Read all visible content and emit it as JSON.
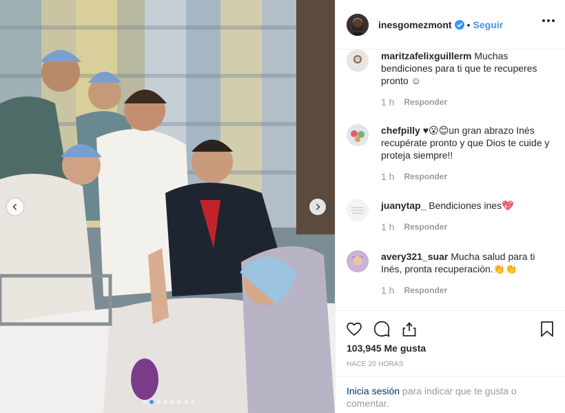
{
  "header": {
    "username": "inesgomezmont",
    "separator": "•",
    "follow_label": "Seguir",
    "verified_icon": "verified-badge-icon",
    "more_icon": "more-options-icon"
  },
  "comments": [
    {
      "user": "maritzafelixguillerm",
      "text": "Muchas bendiciones para ti que te recuperes pronto ☺",
      "time": "1 h",
      "reply": "Responder"
    },
    {
      "user": "chefpilly",
      "text": "♥😮😊un gran abrazo Inés recupérate pronto y que Dios te cuide y proteja siempre!!",
      "time": "1 h",
      "reply": "Responder"
    },
    {
      "user": "juanytap_",
      "text": "Bendiciones ines💖",
      "time": "1 h",
      "reply": "Responder"
    },
    {
      "user": "avery321_suar",
      "text": "Mucha salud para ti Inés, pronta recuperación.👏👏",
      "time": "1 h",
      "reply": "Responder"
    }
  ],
  "actions": {
    "likes": "103,945 Me gusta",
    "posted": "HACE 20 HORAS",
    "icons": [
      "heart-icon",
      "comment-icon",
      "share-icon",
      "bookmark-icon"
    ]
  },
  "login": {
    "link": "Inicia sesión",
    "rest": " para indicar que te gusta o comentar."
  },
  "carousel": {
    "current": 1,
    "total": 8
  },
  "colors": {
    "accent": "#3897f0",
    "link": "#003569",
    "muted": "#999999"
  }
}
